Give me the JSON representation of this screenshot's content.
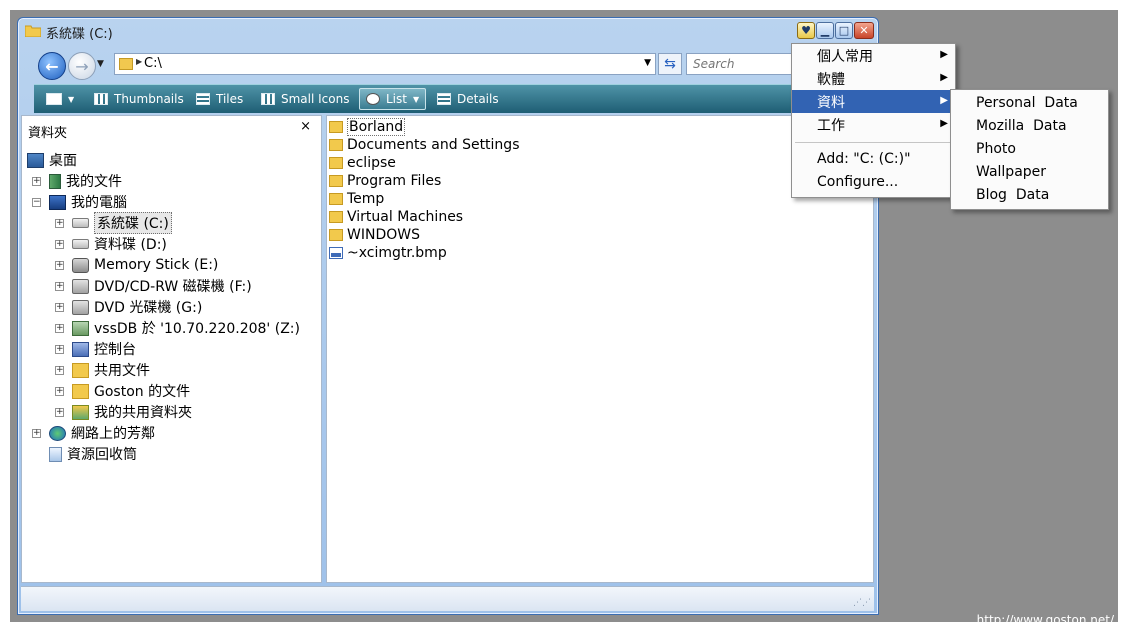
{
  "window": {
    "title": "系統碟 (C:)",
    "buttons": {
      "minimize": "▁",
      "maximize": "□",
      "close": "✕"
    }
  },
  "address": {
    "value": "C:\\",
    "search_placeholder": "Search"
  },
  "toolbar": {
    "thumbnails": "Thumbnails",
    "tiles": "Tiles",
    "small_icons": "Small Icons",
    "list": "List",
    "details": "Details"
  },
  "folders_pane": {
    "title": "資料夾",
    "close": "×",
    "tree": [
      {
        "label": "桌面",
        "icon": "desktop-icon"
      },
      {
        "label": "我的文件",
        "icon": "documents-icon"
      },
      {
        "label": "我的電腦",
        "icon": "computer-icon"
      },
      {
        "label": "系統碟 (C:)",
        "icon": "drive-icon"
      },
      {
        "label": "資料碟 (D:)",
        "icon": "drive-icon"
      },
      {
        "label": "Memory Stick (E:)",
        "icon": "memory-card-icon"
      },
      {
        "label": "DVD/CD-RW 磁碟機 (F:)",
        "icon": "dvd-drive-icon"
      },
      {
        "label": "DVD 光碟機 (G:)",
        "icon": "dvd-drive-icon"
      },
      {
        "label": "vssDB 於 '10.70.220.208' (Z:)",
        "icon": "network-drive-icon"
      },
      {
        "label": "控制台",
        "icon": "control-panel-icon"
      },
      {
        "label": "共用文件",
        "icon": "folder-icon"
      },
      {
        "label": "Goston 的文件",
        "icon": "folder-icon"
      },
      {
        "label": "我的共用資料夾",
        "icon": "shared-folder-icon"
      },
      {
        "label": "網路上的芳鄰",
        "icon": "network-icon"
      },
      {
        "label": "資源回收筒",
        "icon": "recycle-bin-icon"
      }
    ]
  },
  "files": [
    {
      "name": "Borland",
      "icon": "folder-icon"
    },
    {
      "name": "Documents and Settings",
      "icon": "folder-icon"
    },
    {
      "name": "eclipse",
      "icon": "folder-icon"
    },
    {
      "name": "Program Files",
      "icon": "folder-icon"
    },
    {
      "name": "Temp",
      "icon": "folder-icon"
    },
    {
      "name": "Virtual Machines",
      "icon": "folder-icon"
    },
    {
      "name": "WINDOWS",
      "icon": "folder-icon"
    },
    {
      "name": "~xcimgtr.bmp",
      "icon": "bitmap-file-icon"
    }
  ],
  "context_menu": {
    "items": [
      {
        "label": "個人常用",
        "submenu": true
      },
      {
        "label": "軟體",
        "submenu": true
      },
      {
        "label": "資料",
        "submenu": true,
        "highlighted": true
      },
      {
        "label": "工作",
        "submenu": true
      },
      {
        "label": "Add: \"C:  (C:)\"",
        "submenu": false
      },
      {
        "label": "Configure...",
        "submenu": false
      }
    ]
  },
  "submenu": {
    "items": [
      "Personal  Data",
      "Mozilla  Data",
      "Photo",
      "Wallpaper",
      "Blog  Data"
    ]
  },
  "watermark": "http://www.goston.net/",
  "colors": {
    "menu_highlight": "#3263b3",
    "toolbar": "#2a6b82",
    "desktop": "#8d8d8d"
  }
}
